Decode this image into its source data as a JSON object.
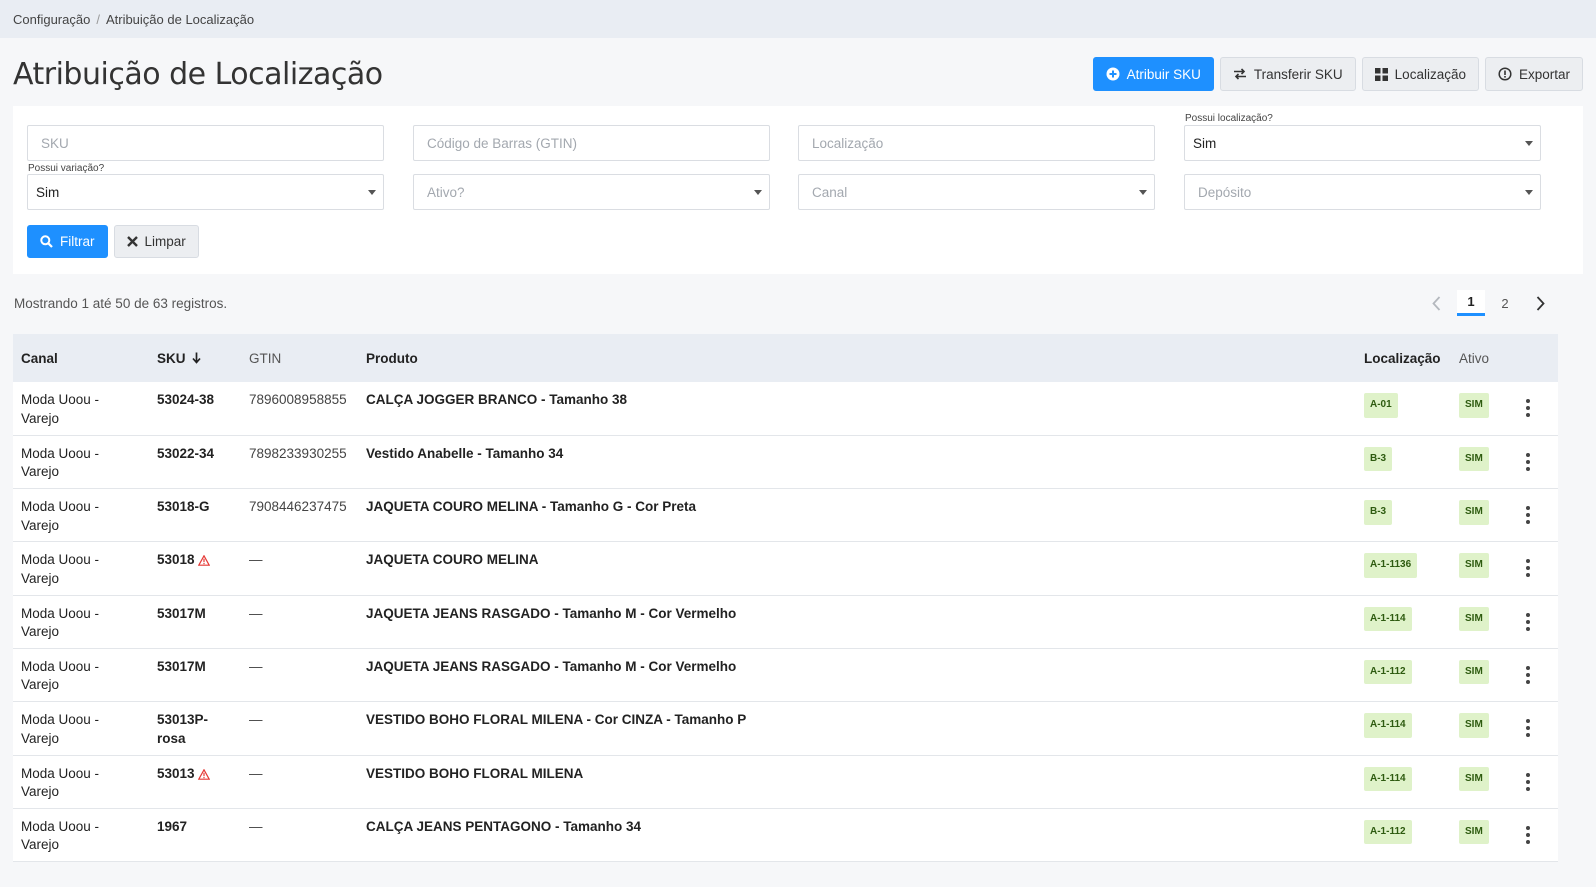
{
  "breadcrumb": {
    "items": [
      "Configuração",
      "Atribuição de Localização"
    ]
  },
  "page": {
    "title": "Atribuição de Localização",
    "actions": [
      {
        "label": "Atribuir SKU",
        "icon": "plus-circle-icon"
      },
      {
        "label": "Transferir SKU",
        "icon": "swap-arrows-icon"
      },
      {
        "label": "Localização",
        "icon": "grid-icon"
      },
      {
        "label": "Exportar",
        "icon": "export-circle-icon"
      }
    ]
  },
  "filters": {
    "sku": {
      "placeholder": "SKU"
    },
    "gtin": {
      "placeholder": "Código de Barras (GTIN)"
    },
    "localizacao": {
      "placeholder": "Localização"
    },
    "possui_localizacao": {
      "label": "Possui localização?",
      "value": "Sim"
    },
    "possui_variacao": {
      "label": "Possui variação?",
      "value": "Sim"
    },
    "ativo": {
      "placeholder": "Ativo?"
    },
    "canal": {
      "placeholder": "Canal"
    },
    "deposito": {
      "placeholder": "Depósito"
    },
    "filter_button": "Filtrar",
    "clear_button": "Limpar"
  },
  "records_info": "Mostrando 1 até 50 de 63 registros.",
  "pagination": {
    "pages": [
      "1",
      "2"
    ],
    "current": "1"
  },
  "table": {
    "columns": [
      "Canal",
      "SKU",
      "GTIN",
      "Produto",
      "Localização",
      "Ativo"
    ],
    "rows": [
      {
        "canal_line1": "Moda Uoou -",
        "canal_line2": "Varejo",
        "sku": "53024-38",
        "sku_line2": "",
        "warning": false,
        "gtin": "7896008958855",
        "produto": "CALÇA JOGGER BRANCO - Tamanho 38",
        "localizacao": "A-01",
        "ativo": "SIM"
      },
      {
        "canal_line1": "Moda Uoou -",
        "canal_line2": "Varejo",
        "sku": "53022-34",
        "sku_line2": "",
        "warning": false,
        "gtin": "7898233930255",
        "produto": "Vestido Anabelle - Tamanho 34",
        "localizacao": "B-3",
        "ativo": "SIM"
      },
      {
        "canal_line1": "Moda Uoou -",
        "canal_line2": "Varejo",
        "sku": "53018-G",
        "sku_line2": "",
        "warning": false,
        "gtin": "7908446237475",
        "produto": "JAQUETA COURO MELINA - Tamanho G - Cor Preta",
        "localizacao": "B-3",
        "ativo": "SIM"
      },
      {
        "canal_line1": "Moda Uoou -",
        "canal_line2": "Varejo",
        "sku": "53018",
        "sku_line2": "",
        "warning": true,
        "gtin": "—",
        "produto": "JAQUETA COURO MELINA",
        "localizacao": "A-1-1136",
        "ativo": "SIM"
      },
      {
        "canal_line1": "Moda Uoou -",
        "canal_line2": "Varejo",
        "sku": "53017M",
        "sku_line2": "",
        "warning": false,
        "gtin": "—",
        "produto": "JAQUETA JEANS RASGADO - Tamanho M - Cor Vermelho",
        "localizacao": "A-1-114",
        "ativo": "SIM"
      },
      {
        "canal_line1": "Moda Uoou -",
        "canal_line2": "Varejo",
        "sku": "53017M",
        "sku_line2": "",
        "warning": false,
        "gtin": "—",
        "produto": "JAQUETA JEANS RASGADO - Tamanho M - Cor Vermelho",
        "localizacao": "A-1-112",
        "ativo": "SIM"
      },
      {
        "canal_line1": "Moda Uoou -",
        "canal_line2": "Varejo",
        "sku": "53013P-",
        "sku_line2": "rosa",
        "warning": false,
        "gtin": "—",
        "produto": "VESTIDO BOHO FLORAL MILENA - Cor CINZA - Tamanho P",
        "localizacao": "A-1-114",
        "ativo": "SIM"
      },
      {
        "canal_line1": "Moda Uoou -",
        "canal_line2": "Varejo",
        "sku": "53013",
        "sku_line2": "",
        "warning": true,
        "gtin": "—",
        "produto": "VESTIDO BOHO FLORAL MILENA",
        "localizacao": "A-1-114",
        "ativo": "SIM"
      },
      {
        "canal_line1": "Moda Uoou -",
        "canal_line2": "Varejo",
        "sku": "1967",
        "sku_line2": "",
        "warning": false,
        "gtin": "—",
        "produto": "CALÇA JEANS PENTAGONO - Tamanho 34",
        "localizacao": "A-1-112",
        "ativo": "SIM"
      }
    ]
  },
  "colors": {
    "primary": "#1e90ff",
    "badge_bg": "#dff2c9",
    "badge_text": "#2e5b10",
    "warning": "#e53935"
  }
}
